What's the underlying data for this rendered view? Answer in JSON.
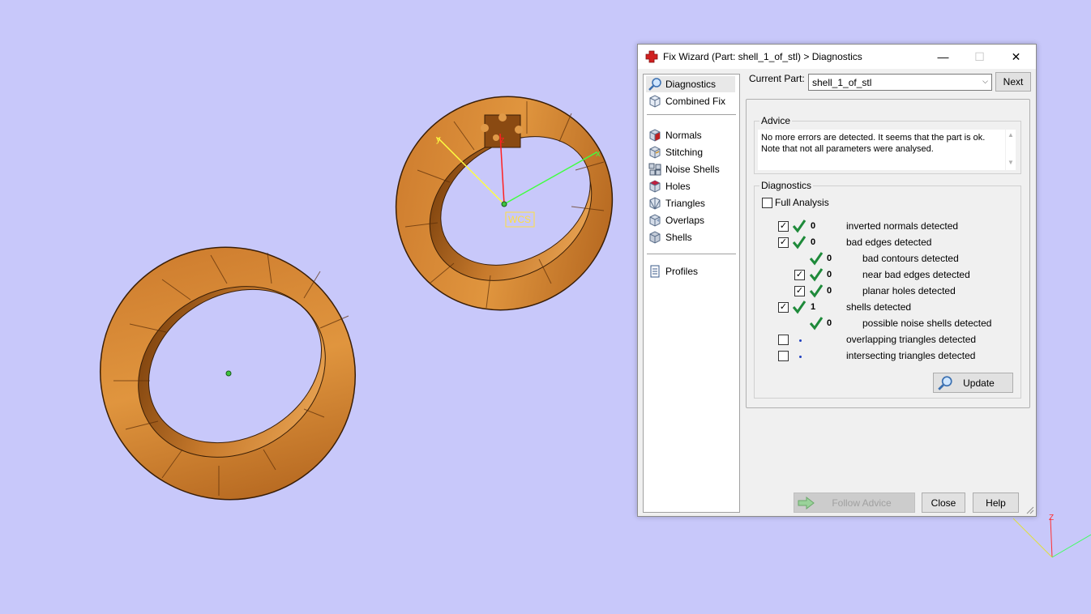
{
  "viewport": {
    "background": "#c8c8fa",
    "model_color": "#d98a3a",
    "wcs_label": "WCS",
    "axis_x_label": "x",
    "axis_y_label": "y",
    "axis_z_label": "z",
    "mini_axis_z_label": "Z"
  },
  "dialog": {
    "title": "Fix Wizard (Part: shell_1_of_stl) > Diagnostics",
    "window_buttons": {
      "minimize": "—",
      "maximize": "☐",
      "close": "✕"
    },
    "nav": {
      "items": [
        {
          "label": "Diagnostics",
          "icon": "magnifier-icon",
          "selected": true
        },
        {
          "label": "Combined Fix",
          "icon": "cube-icon"
        },
        {
          "label": "Normals",
          "icon": "normals-cube-icon"
        },
        {
          "label": "Stitching",
          "icon": "stitching-cube-icon"
        },
        {
          "label": "Noise Shells",
          "icon": "noise-shells-icon"
        },
        {
          "label": "Holes",
          "icon": "holes-cube-icon"
        },
        {
          "label": "Triangles",
          "icon": "triangles-icon"
        },
        {
          "label": "Overlaps",
          "icon": "overlaps-icon"
        },
        {
          "label": "Shells",
          "icon": "shells-icon"
        },
        {
          "label": "Profiles",
          "icon": "document-icon"
        }
      ]
    },
    "current_part_label": "Current Part:",
    "current_part_value": "shell_1_of_stl",
    "next_button": "Next",
    "advice": {
      "title": "Advice",
      "line1": "No more errors are detected. It seems that the part is ok.",
      "line2": "Note that not all parameters were analysed."
    },
    "diagnostics": {
      "title": "Diagnostics",
      "full_analysis_label": "Full Analysis",
      "full_analysis_checked": false,
      "rows": [
        {
          "checkbox": true,
          "checked": true,
          "status": "ok",
          "count": "0",
          "label": "inverted normals detected"
        },
        {
          "checkbox": true,
          "checked": true,
          "status": "ok",
          "count": "0",
          "label": "bad edges detected"
        },
        {
          "checkbox": false,
          "status": "ok",
          "count": "0",
          "label": "bad contours detected",
          "indent": true
        },
        {
          "checkbox": true,
          "checked": true,
          "status": "ok",
          "count": "0",
          "label": "near bad edges detected",
          "indent": true
        },
        {
          "checkbox": true,
          "checked": true,
          "status": "ok",
          "count": "0",
          "label": "planar holes detected",
          "indent": true
        },
        {
          "checkbox": true,
          "checked": true,
          "status": "ok",
          "count": "1",
          "label": "shells detected"
        },
        {
          "checkbox": false,
          "status": "ok",
          "count": "0",
          "label": "possible noise shells detected",
          "indent": true
        },
        {
          "checkbox": true,
          "checked": false,
          "status": "not-run",
          "count": "",
          "label": "overlapping triangles detected"
        },
        {
          "checkbox": true,
          "checked": false,
          "status": "not-run",
          "count": "",
          "label": "intersecting triangles detected"
        }
      ],
      "update_button": "Update"
    },
    "footer": {
      "follow_advice_button": "Follow Advice",
      "close_button": "Close",
      "help_button": "Help"
    }
  }
}
